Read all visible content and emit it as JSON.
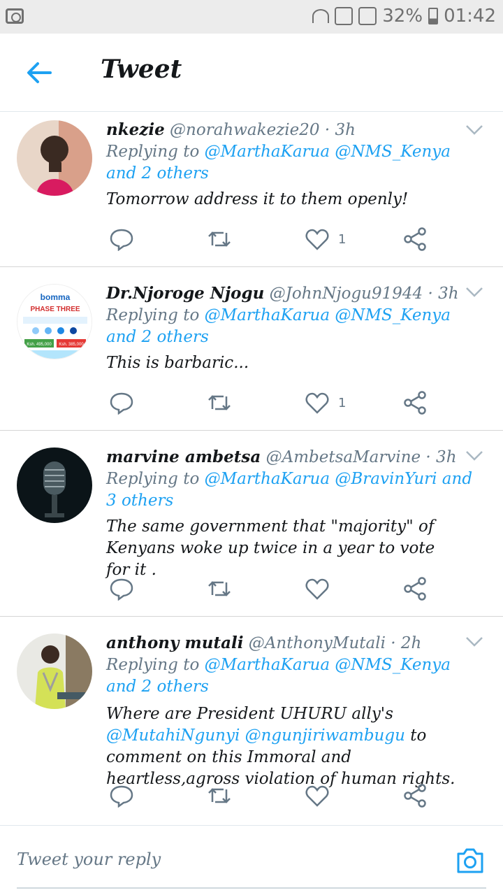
{
  "status_bar": {
    "battery": "32%",
    "time": "01:42"
  },
  "header": {
    "title": "Tweet"
  },
  "colors": {
    "accent": "#1da1f2",
    "muted": "#657786",
    "text": "#14171a"
  },
  "tweets": [
    {
      "name": "nkezie",
      "handle": "@norahwakezie20 · 3h",
      "replying_prefix": "Replying to ",
      "replying_links": "@MarthaKarua @NMS_Kenya and 2 others",
      "text": "Tomorrow address it to them openly!",
      "likes": "1"
    },
    {
      "name": "Dr.Njoroge Njogu",
      "handle": "@JohnNjogu91944 · 3h",
      "replying_prefix": "Replying to ",
      "replying_links": "@MarthaKarua @NMS_Kenya and 2 others",
      "text": "This is barbaric...",
      "likes": "1",
      "avatar_text": {
        "brand": "bomma",
        "phase": "PHASE THREE",
        "price1": "Ksh. 495,000",
        "price2": "Ksh. 385,000"
      }
    },
    {
      "name": "marvine ambetsa",
      "handle": "@AmbetsaMarvine · 3h",
      "replying_prefix": "Replying to ",
      "replying_links": "@MarthaKarua @BravinYuri and 3 others",
      "text": "The same government that \"majority\" of Kenyans woke up twice in a year to vote for it .",
      "likes": ""
    },
    {
      "name": "anthony mutali",
      "handle": "@AnthonyMutali · 2h",
      "replying_prefix": "Replying to ",
      "replying_links": "@MarthaKarua @NMS_Kenya and 2 others",
      "text_pre": "Where are President UHURU ally's ",
      "text_mentions": "@MutahiNgunyi @ngunjiriwambugu",
      "text_post": " to comment on this Immoral and heartless,agross violation of human rights.",
      "likes": ""
    }
  ],
  "composer": {
    "placeholder": "Tweet your reply"
  },
  "icons": [
    "back-arrow-icon",
    "reply-icon",
    "retweet-icon",
    "like-icon",
    "share-icon",
    "chevron-down-icon",
    "camera-icon"
  ]
}
